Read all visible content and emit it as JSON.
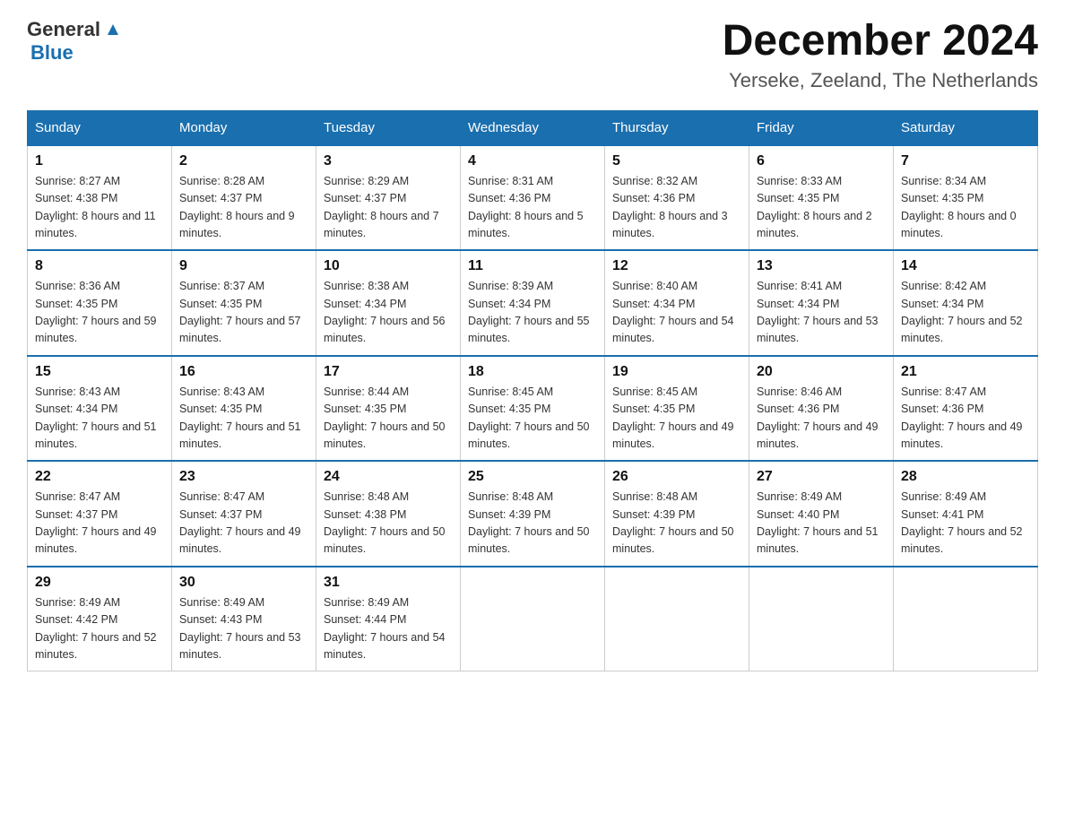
{
  "header": {
    "logo_general": "General",
    "logo_blue": "Blue",
    "month_year": "December 2024",
    "location": "Yerseke, Zeeland, The Netherlands"
  },
  "days_of_week": [
    "Sunday",
    "Monday",
    "Tuesday",
    "Wednesday",
    "Thursday",
    "Friday",
    "Saturday"
  ],
  "weeks": [
    [
      {
        "num": "1",
        "sunrise": "8:27 AM",
        "sunset": "4:38 PM",
        "daylight": "8 hours and 11 minutes."
      },
      {
        "num": "2",
        "sunrise": "8:28 AM",
        "sunset": "4:37 PM",
        "daylight": "8 hours and 9 minutes."
      },
      {
        "num": "3",
        "sunrise": "8:29 AM",
        "sunset": "4:37 PM",
        "daylight": "8 hours and 7 minutes."
      },
      {
        "num": "4",
        "sunrise": "8:31 AM",
        "sunset": "4:36 PM",
        "daylight": "8 hours and 5 minutes."
      },
      {
        "num": "5",
        "sunrise": "8:32 AM",
        "sunset": "4:36 PM",
        "daylight": "8 hours and 3 minutes."
      },
      {
        "num": "6",
        "sunrise": "8:33 AM",
        "sunset": "4:35 PM",
        "daylight": "8 hours and 2 minutes."
      },
      {
        "num": "7",
        "sunrise": "8:34 AM",
        "sunset": "4:35 PM",
        "daylight": "8 hours and 0 minutes."
      }
    ],
    [
      {
        "num": "8",
        "sunrise": "8:36 AM",
        "sunset": "4:35 PM",
        "daylight": "7 hours and 59 minutes."
      },
      {
        "num": "9",
        "sunrise": "8:37 AM",
        "sunset": "4:35 PM",
        "daylight": "7 hours and 57 minutes."
      },
      {
        "num": "10",
        "sunrise": "8:38 AM",
        "sunset": "4:34 PM",
        "daylight": "7 hours and 56 minutes."
      },
      {
        "num": "11",
        "sunrise": "8:39 AM",
        "sunset": "4:34 PM",
        "daylight": "7 hours and 55 minutes."
      },
      {
        "num": "12",
        "sunrise": "8:40 AM",
        "sunset": "4:34 PM",
        "daylight": "7 hours and 54 minutes."
      },
      {
        "num": "13",
        "sunrise": "8:41 AM",
        "sunset": "4:34 PM",
        "daylight": "7 hours and 53 minutes."
      },
      {
        "num": "14",
        "sunrise": "8:42 AM",
        "sunset": "4:34 PM",
        "daylight": "7 hours and 52 minutes."
      }
    ],
    [
      {
        "num": "15",
        "sunrise": "8:43 AM",
        "sunset": "4:34 PM",
        "daylight": "7 hours and 51 minutes."
      },
      {
        "num": "16",
        "sunrise": "8:43 AM",
        "sunset": "4:35 PM",
        "daylight": "7 hours and 51 minutes."
      },
      {
        "num": "17",
        "sunrise": "8:44 AM",
        "sunset": "4:35 PM",
        "daylight": "7 hours and 50 minutes."
      },
      {
        "num": "18",
        "sunrise": "8:45 AM",
        "sunset": "4:35 PM",
        "daylight": "7 hours and 50 minutes."
      },
      {
        "num": "19",
        "sunrise": "8:45 AM",
        "sunset": "4:35 PM",
        "daylight": "7 hours and 49 minutes."
      },
      {
        "num": "20",
        "sunrise": "8:46 AM",
        "sunset": "4:36 PM",
        "daylight": "7 hours and 49 minutes."
      },
      {
        "num": "21",
        "sunrise": "8:47 AM",
        "sunset": "4:36 PM",
        "daylight": "7 hours and 49 minutes."
      }
    ],
    [
      {
        "num": "22",
        "sunrise": "8:47 AM",
        "sunset": "4:37 PM",
        "daylight": "7 hours and 49 minutes."
      },
      {
        "num": "23",
        "sunrise": "8:47 AM",
        "sunset": "4:37 PM",
        "daylight": "7 hours and 49 minutes."
      },
      {
        "num": "24",
        "sunrise": "8:48 AM",
        "sunset": "4:38 PM",
        "daylight": "7 hours and 50 minutes."
      },
      {
        "num": "25",
        "sunrise": "8:48 AM",
        "sunset": "4:39 PM",
        "daylight": "7 hours and 50 minutes."
      },
      {
        "num": "26",
        "sunrise": "8:48 AM",
        "sunset": "4:39 PM",
        "daylight": "7 hours and 50 minutes."
      },
      {
        "num": "27",
        "sunrise": "8:49 AM",
        "sunset": "4:40 PM",
        "daylight": "7 hours and 51 minutes."
      },
      {
        "num": "28",
        "sunrise": "8:49 AM",
        "sunset": "4:41 PM",
        "daylight": "7 hours and 52 minutes."
      }
    ],
    [
      {
        "num": "29",
        "sunrise": "8:49 AM",
        "sunset": "4:42 PM",
        "daylight": "7 hours and 52 minutes."
      },
      {
        "num": "30",
        "sunrise": "8:49 AM",
        "sunset": "4:43 PM",
        "daylight": "7 hours and 53 minutes."
      },
      {
        "num": "31",
        "sunrise": "8:49 AM",
        "sunset": "4:44 PM",
        "daylight": "7 hours and 54 minutes."
      },
      null,
      null,
      null,
      null
    ]
  ]
}
